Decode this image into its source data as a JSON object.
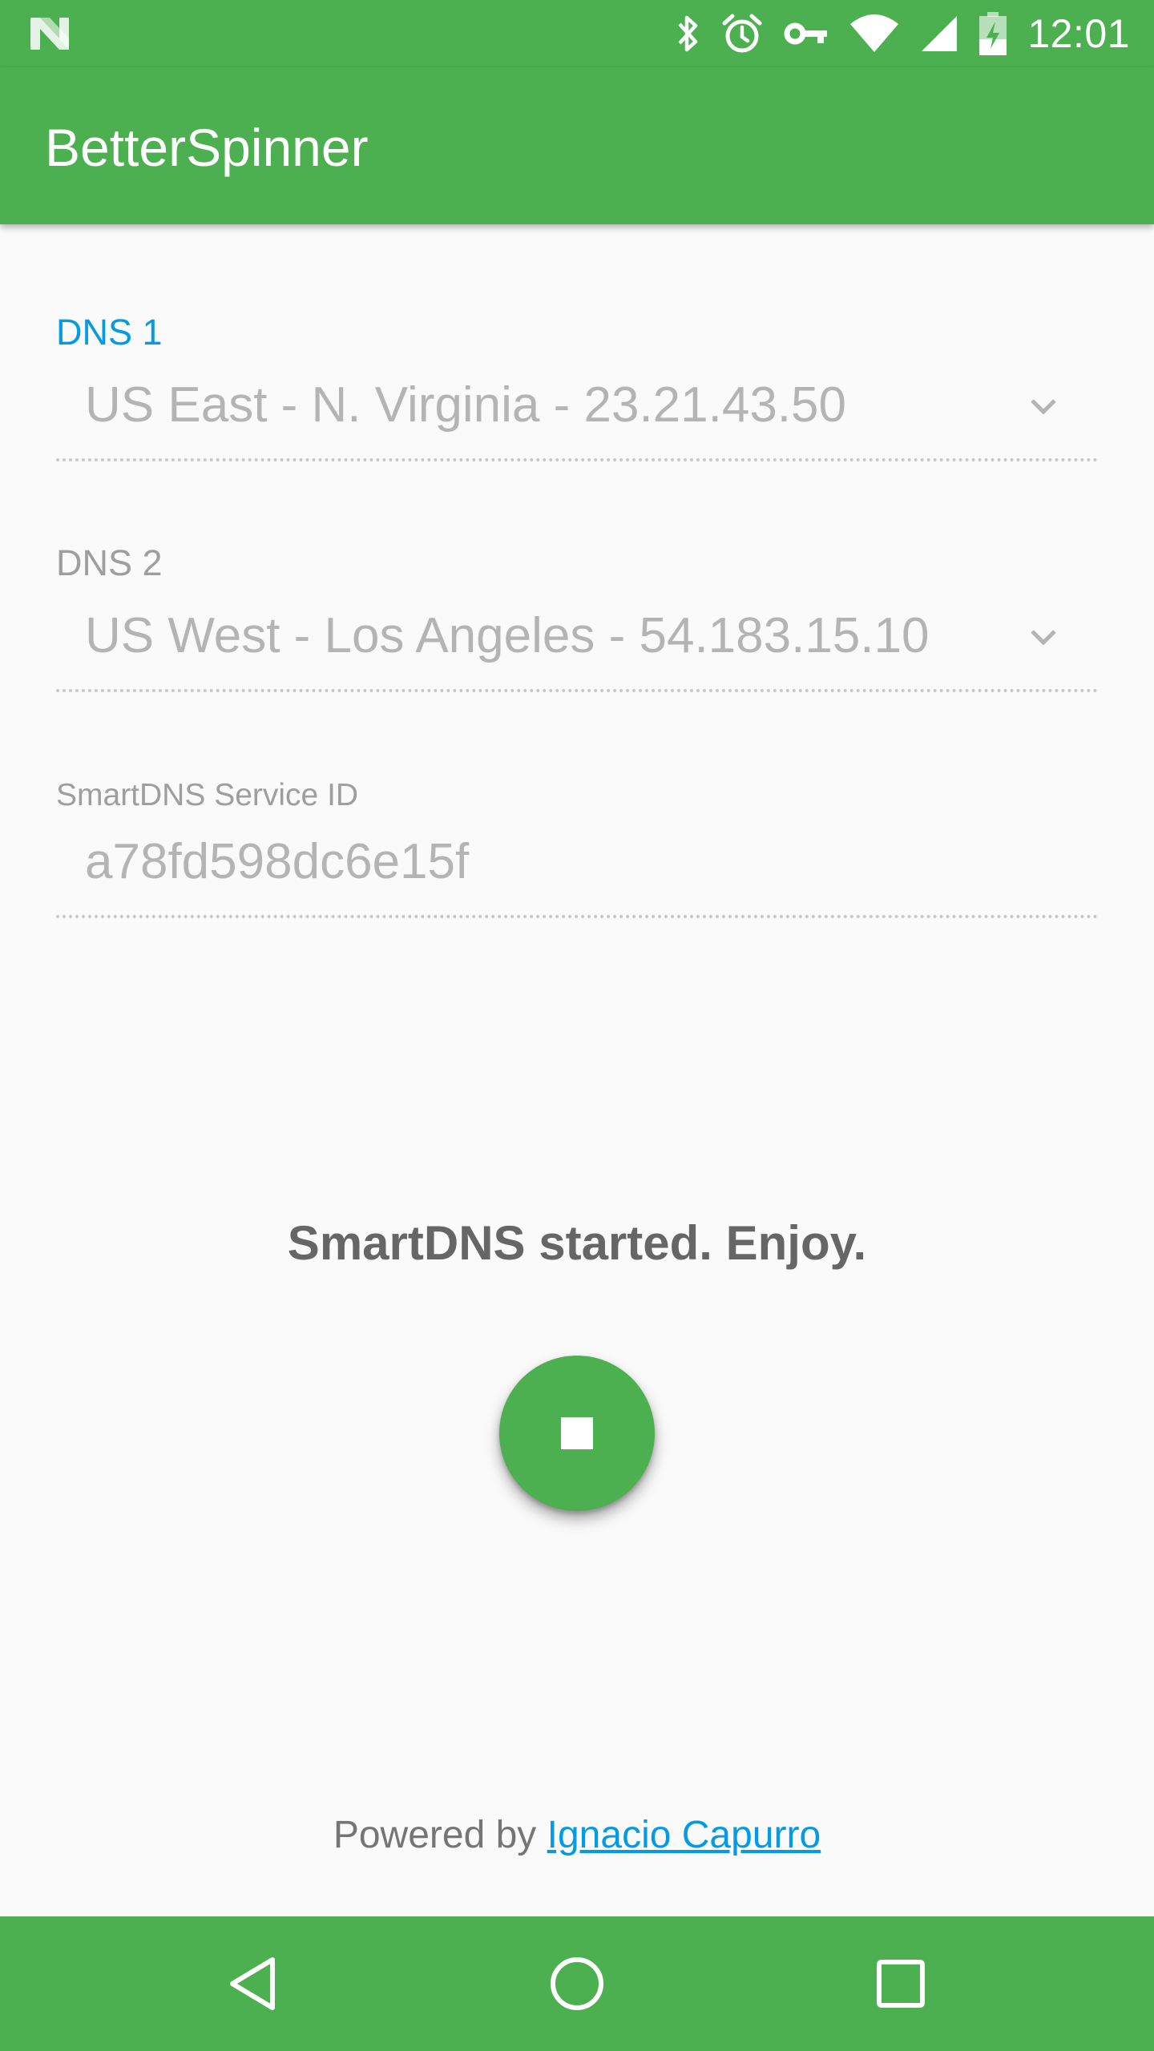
{
  "status_bar": {
    "time": "12:01",
    "icons": [
      "n-logo-icon",
      "bluetooth-icon",
      "alarm-icon",
      "vpn-key-icon",
      "wifi-icon",
      "cell-signal-icon",
      "battery-charging-icon"
    ]
  },
  "app_bar": {
    "title": "BetterSpinner"
  },
  "form": {
    "dns1": {
      "label": "DNS 1",
      "value": "US East - N. Virginia - 23.21.43.50"
    },
    "dns2": {
      "label": "DNS 2",
      "value": "US West - Los Angeles - 54.183.15.10"
    },
    "service_id": {
      "label": "SmartDNS Service ID",
      "value": "a78fd598dc6e15f"
    }
  },
  "status_message": "SmartDNS started. Enjoy.",
  "fab": {
    "icon": "stop-icon"
  },
  "footer": {
    "prefix": "Powered by",
    "link_text": "Ignacio Capurro"
  },
  "nav_bar": {
    "icons": [
      "back-icon",
      "home-icon",
      "recents-icon"
    ]
  },
  "colors": {
    "primary": "#4caf50",
    "accent": "#039be5",
    "background": "#fafafa",
    "hint_text": "#b4b4b4",
    "message_text": "#666666"
  }
}
